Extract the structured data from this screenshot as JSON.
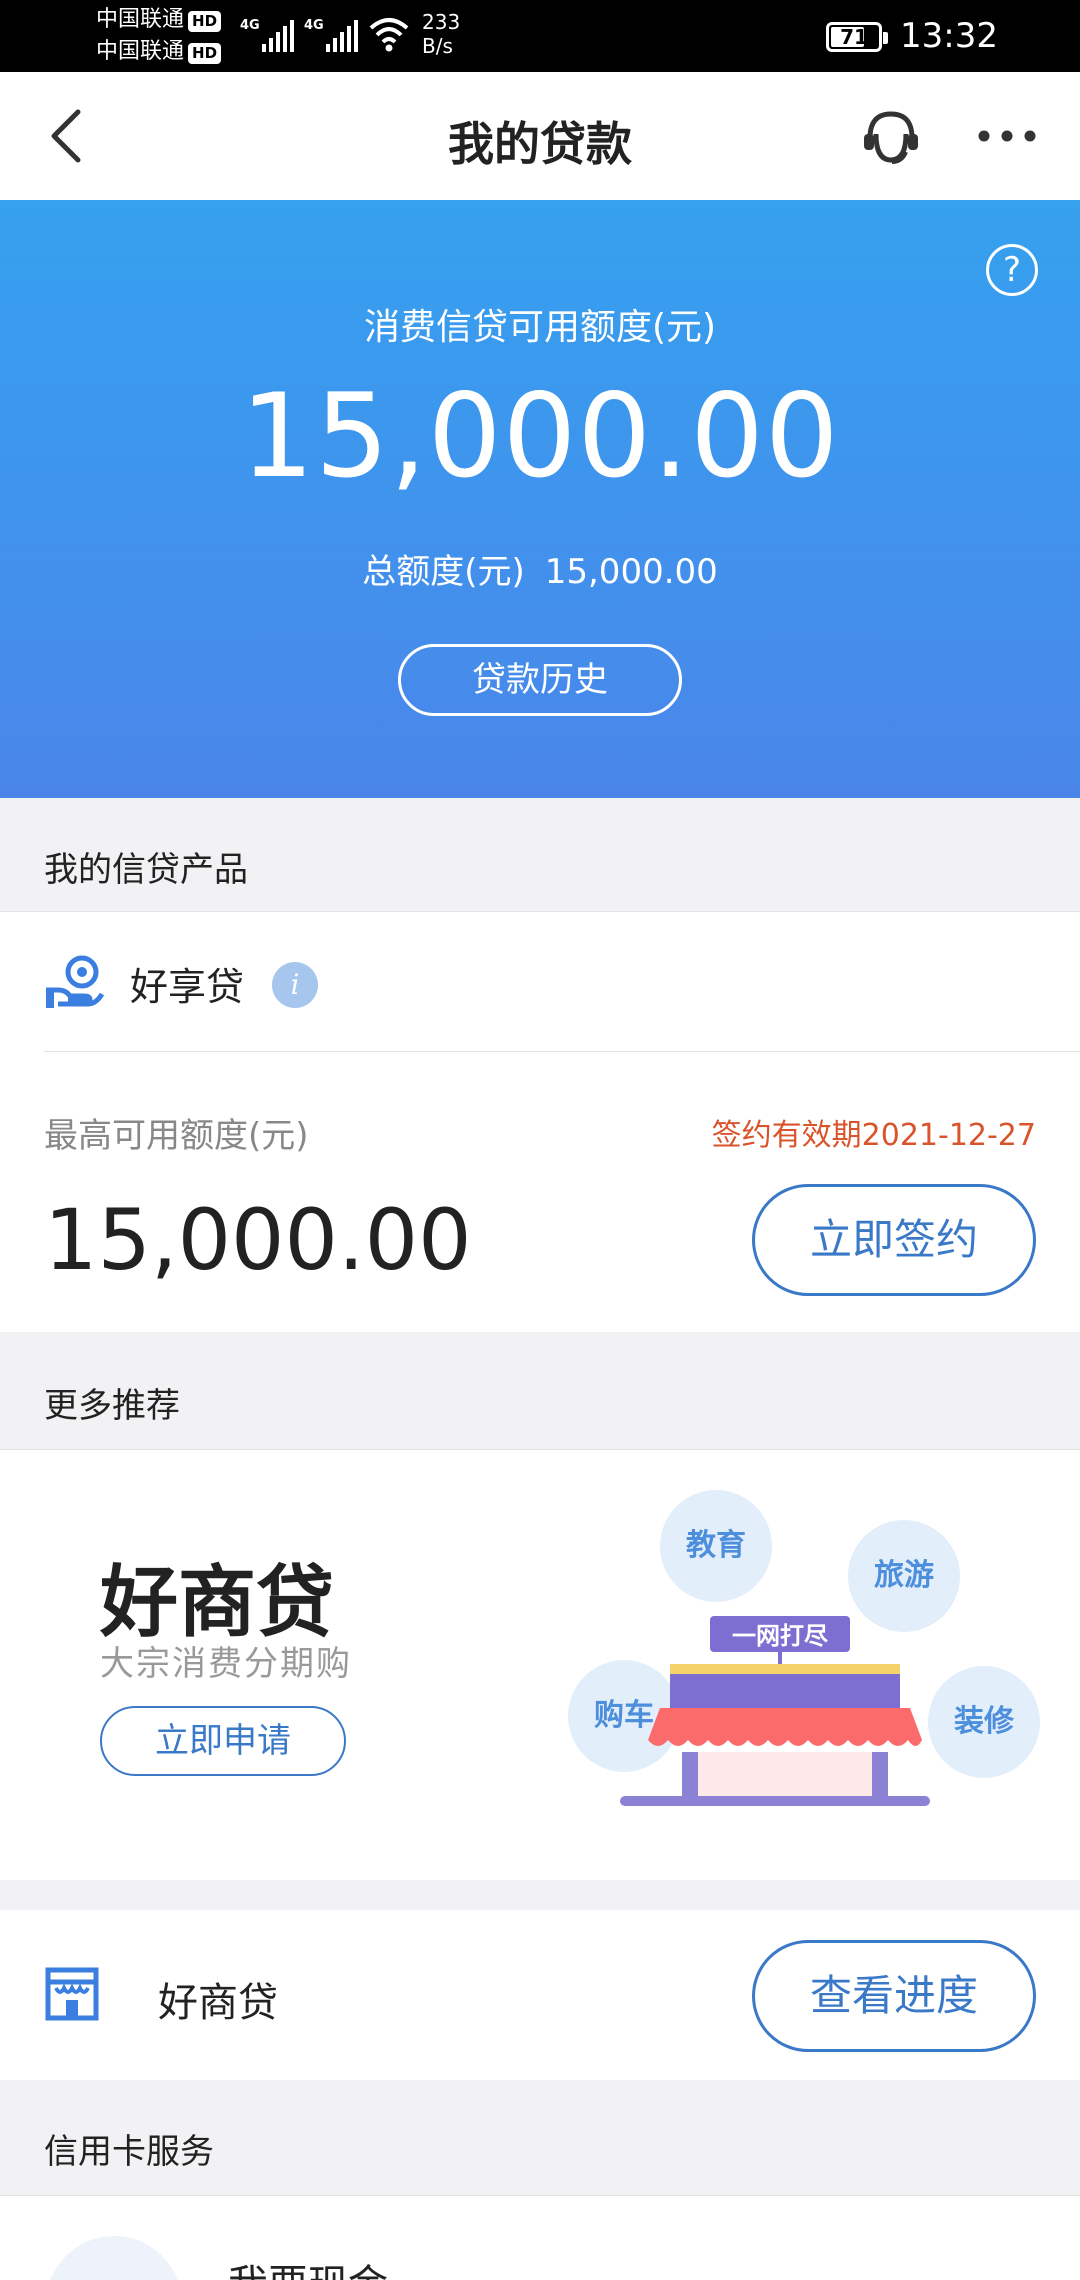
{
  "status_bar": {
    "carrier1": "中国联通",
    "carrier2": "中国联通",
    "hd": "HD",
    "net1": "4G",
    "net2": "4G",
    "speed_value": "233",
    "speed_unit": "B/s",
    "battery": "71",
    "battery_level": 0.71,
    "time": "13:32"
  },
  "nav": {
    "title": "我的贷款",
    "back_icon": "chevron-left-icon",
    "service_icon": "customer-service-icon",
    "more_icon": "more-dots-icon"
  },
  "hero": {
    "label": "消费信贷可用额度(元)",
    "amount": "15,000.00",
    "total_label": "总额度(元)",
    "total_value": "15,000.00",
    "history_button": "贷款历史",
    "help_icon": "?",
    "colors": {
      "top": "#35a1ef",
      "bottom": "#4a86ea"
    }
  },
  "my_products": {
    "header": "我的信贷产品",
    "product_name": "好享贷",
    "info_icon": "i",
    "limit_label": "最高可用额度(元)",
    "expire_text": "签约有效期2021-12-27",
    "limit_value": "15,000.00",
    "sign_button": "立即签约"
  },
  "more": {
    "header": "更多推荐",
    "promo_title": "好商贷",
    "promo_subtitle": "大宗消费分期购",
    "apply_button": "立即申请",
    "banner_text": "一网打尽",
    "bubbles": [
      "教育",
      "旅游",
      "购车",
      "装修"
    ]
  },
  "progress_row": {
    "name": "好商贷",
    "button": "查看进度"
  },
  "credit_card": {
    "header": "信用卡服务",
    "item_title": "我要现金"
  },
  "colors": {
    "accent": "#3a78c8",
    "warning": "#d9532b",
    "page_bg": "#f2f2f4"
  }
}
